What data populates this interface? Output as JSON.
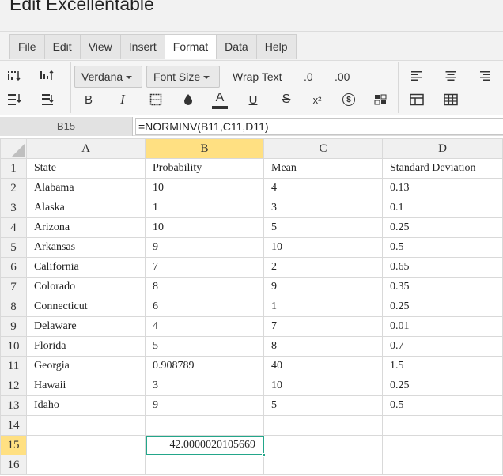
{
  "app": {
    "title": "Edit Excellentable"
  },
  "menu": {
    "tabs": [
      {
        "label": "File",
        "active": false
      },
      {
        "label": "Edit",
        "active": false
      },
      {
        "label": "View",
        "active": false
      },
      {
        "label": "Insert",
        "active": false
      },
      {
        "label": "Format",
        "active": true
      },
      {
        "label": "Data",
        "active": false
      },
      {
        "label": "Help",
        "active": false
      }
    ]
  },
  "toolbar": {
    "font_family": "Verdana",
    "font_size": "Font Size",
    "wrap_text": "Wrap Text",
    "decrease_decimal": ".0",
    "increase_decimal": ".00",
    "bold": "B",
    "italic": "I",
    "text_color_glyph": "A",
    "underline": "U",
    "strikethrough": "S",
    "superscript": "x²",
    "currency": "$",
    "icons": [
      "indent-icon",
      "outdent-icon",
      "line-height-icon",
      "wrap-lines-icon",
      "border-icon",
      "fill-color-icon",
      "align-left-icon",
      "align-center-icon",
      "align-right-icon",
      "merge-cells-icon",
      "table-grid-icon",
      "conditional-format-icon"
    ],
    "accent_color": "#23a68a"
  },
  "formula_bar": {
    "cell_reference": "B15",
    "formula": "=NORMINV(B11,C11,D11)"
  },
  "sheet": {
    "columns": [
      "A",
      "B",
      "C",
      "D"
    ],
    "selected_column": "B",
    "selected_row": "15",
    "rows": [
      {
        "num": "1",
        "cells": [
          "State",
          "Probability",
          "Mean",
          "Standard Deviation"
        ]
      },
      {
        "num": "2",
        "cells": [
          "Alabama",
          "10",
          "4",
          "0.13"
        ]
      },
      {
        "num": "3",
        "cells": [
          "Alaska",
          "1",
          "3",
          "0.1"
        ]
      },
      {
        "num": "4",
        "cells": [
          "Arizona",
          "10",
          "5",
          "0.25"
        ]
      },
      {
        "num": "5",
        "cells": [
          "Arkansas",
          "9",
          "10",
          "0.5"
        ]
      },
      {
        "num": "6",
        "cells": [
          "California",
          "7",
          "2",
          "0.65"
        ]
      },
      {
        "num": "7",
        "cells": [
          "Colorado",
          "8",
          "9",
          "0.35"
        ]
      },
      {
        "num": "8",
        "cells": [
          "Connecticut",
          "6",
          "1",
          "0.25"
        ]
      },
      {
        "num": "9",
        "cells": [
          "Delaware",
          "4",
          "7",
          "0.01"
        ]
      },
      {
        "num": "10",
        "cells": [
          "Florida",
          "5",
          "8",
          "0.7"
        ]
      },
      {
        "num": "11",
        "cells": [
          "Georgia",
          "0.908789",
          "40",
          "1.5"
        ]
      },
      {
        "num": "12",
        "cells": [
          "Hawaii",
          "3",
          "10",
          "0.25"
        ]
      },
      {
        "num": "13",
        "cells": [
          "Idaho",
          "9",
          "5",
          "0.5"
        ]
      },
      {
        "num": "14",
        "cells": [
          "",
          "",
          "",
          ""
        ]
      },
      {
        "num": "15",
        "cells": [
          "",
          "42.0000020105669",
          "",
          ""
        ]
      },
      {
        "num": "16",
        "cells": [
          "",
          "",
          "",
          ""
        ]
      }
    ]
  }
}
